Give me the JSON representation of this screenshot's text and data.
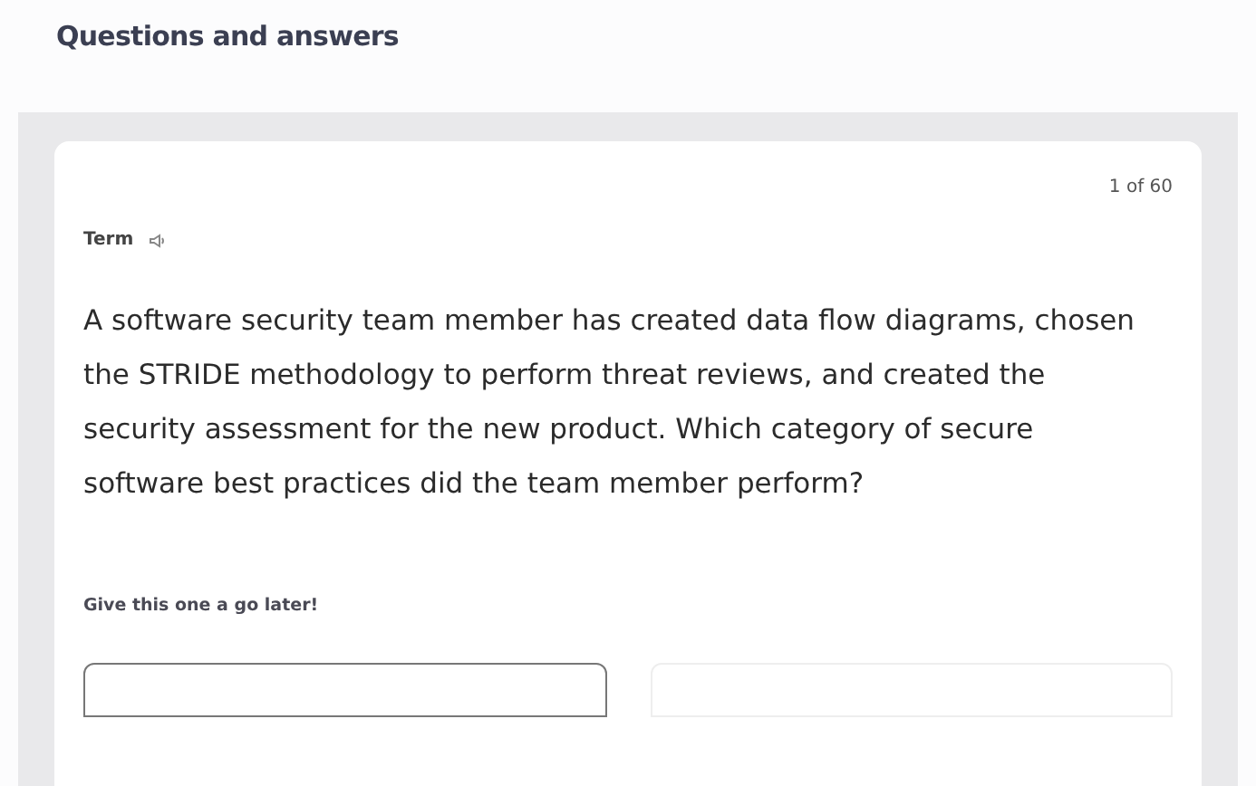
{
  "page_title": "Questions and answers",
  "card": {
    "counter": "1 of 60",
    "label": "Term",
    "question": "A software security team member has created data flow diagrams, chosen the STRIDE methodology to perform threat reviews, and created the security assessment for the new product. Which category of secure software best practices did the team member perform?",
    "later_text": "Give this one a go later!",
    "options": [
      {
        "selected": true
      },
      {
        "selected": false
      }
    ]
  }
}
